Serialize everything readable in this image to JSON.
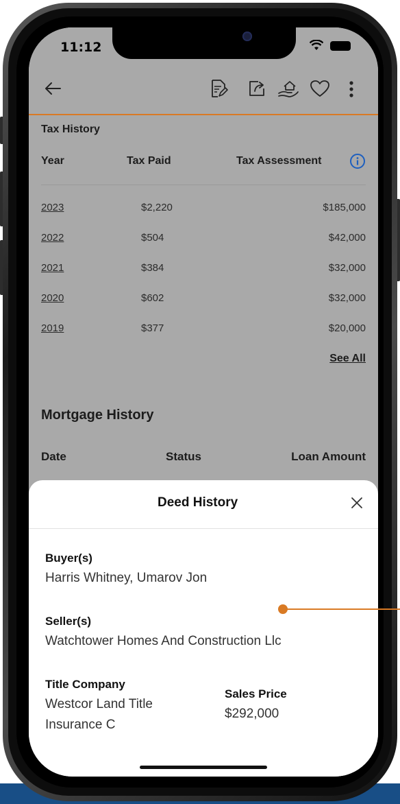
{
  "status_bar": {
    "time": "11:12"
  },
  "toolbar": {
    "back_icon": "arrow-left-icon",
    "icons": [
      "edit-document-icon",
      "share-icon",
      "hand-home-icon",
      "heart-icon",
      "more-vertical-icon"
    ]
  },
  "tax_history": {
    "title": "Tax History",
    "columns": {
      "year": "Year",
      "tax_paid": "Tax Paid",
      "tax_assessment": "Tax Assessment"
    },
    "rows": [
      {
        "year": "2023",
        "tax_paid": "$2,220",
        "tax_assessment": "$185,000"
      },
      {
        "year": "2022",
        "tax_paid": "$504",
        "tax_assessment": "$42,000"
      },
      {
        "year": "2021",
        "tax_paid": "$384",
        "tax_assessment": "$32,000"
      },
      {
        "year": "2020",
        "tax_paid": "$602",
        "tax_assessment": "$32,000"
      },
      {
        "year": "2019",
        "tax_paid": "$377",
        "tax_assessment": "$20,000"
      }
    ],
    "see_all": "See All"
  },
  "mortgage_history": {
    "title": "Mortgage History",
    "columns": {
      "date": "Date",
      "status": "Status",
      "loan_amount": "Loan Amount"
    }
  },
  "deed_history": {
    "title": "Deed History",
    "buyers_label": "Buyer(s)",
    "buyers_value": "Harris Whitney, Umarov Jon",
    "sellers_label": "Seller(s)",
    "sellers_value": "Watchtower Homes And Construction Llc",
    "title_company_label": "Title Company",
    "title_company_line1": "Westcor Land Title",
    "title_company_line2": "Insurance C",
    "sales_price_label": "Sales Price",
    "sales_price_value": "$292,000"
  },
  "colors": {
    "accent": "#d97a24",
    "overlay": "#a9a9a9",
    "band": "#184e86"
  }
}
